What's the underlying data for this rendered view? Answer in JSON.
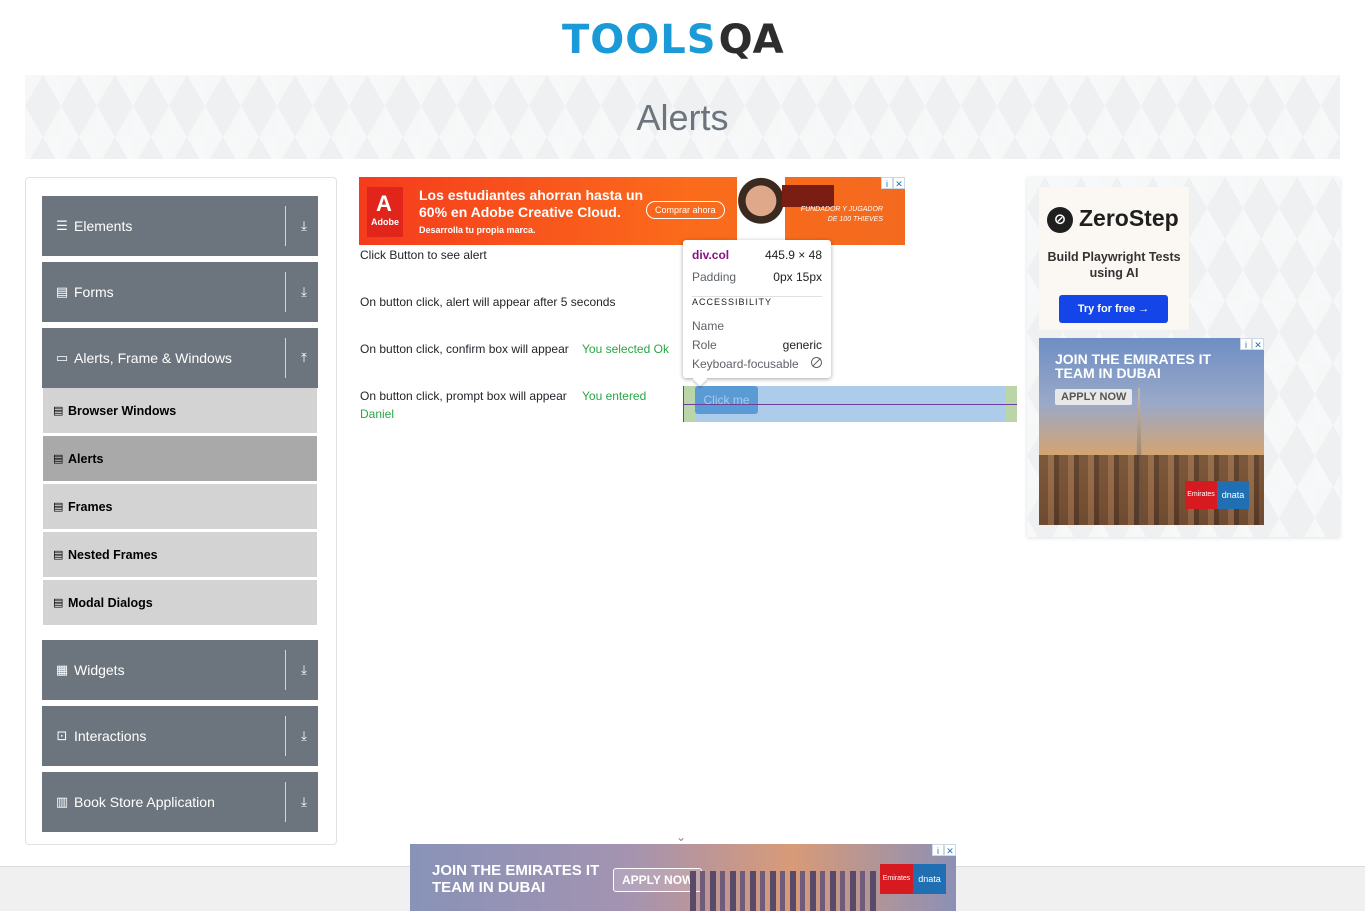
{
  "logo": {
    "text_a": "TOOLS",
    "text_b": "QA"
  },
  "banner": {
    "title": "Alerts"
  },
  "sidebar": {
    "groups": [
      {
        "label": "Elements",
        "icon": "hamburger-icon",
        "arrow": "download-arrow-icon"
      },
      {
        "label": "Forms",
        "icon": "form-icon",
        "arrow": "download-arrow-icon"
      },
      {
        "label": "Alerts, Frame & Windows",
        "icon": "window-icon",
        "arrow": "upload-arrow-icon"
      },
      {
        "label": "Widgets",
        "icon": "grid-icon",
        "arrow": "download-arrow-icon"
      },
      {
        "label": "Interactions",
        "icon": "interactions-icon",
        "arrow": "download-arrow-icon"
      },
      {
        "label": "Book Store Application",
        "icon": "books-icon",
        "arrow": "download-arrow-icon"
      }
    ],
    "sub_items": [
      {
        "label": "Browser Windows",
        "active": false
      },
      {
        "label": "Alerts",
        "active": true
      },
      {
        "label": "Frames",
        "active": false
      },
      {
        "label": "Nested Frames",
        "active": false
      },
      {
        "label": "Modal Dialogs",
        "active": false
      }
    ]
  },
  "ad_top": {
    "brand": "Adobe",
    "headline": "Los estudiantes ahorran hasta un 60% en Adobe Creative Cloud.",
    "subline": "Desarrolla tu propia marca.",
    "cta": "Comprar ahora",
    "tagline": "FUNDADOR Y JUGADOR DE 100 THIEVES"
  },
  "main": {
    "rows": [
      {
        "text": "Click Button to see alert",
        "result": ""
      },
      {
        "text": "On button click, alert will appear after 5 seconds",
        "result": ""
      },
      {
        "text": "On button click, confirm box will appear",
        "result": "You selected Ok"
      },
      {
        "text": "On button click, prompt box will appear",
        "result_a": "You entered",
        "result_b": "Daniel"
      }
    ],
    "highlighted_button": "Click me"
  },
  "inspector": {
    "tag": "div.col",
    "size": "445.9 × 48",
    "padding_label": "Padding",
    "padding_value": "0px 15px",
    "section": "ACCESSIBILITY",
    "name_label": "Name",
    "name_value": "",
    "role_label": "Role",
    "role_value": "generic",
    "focusable_label": "Keyboard-focusable"
  },
  "right_ads": {
    "zerostep": {
      "name": "ZeroStep",
      "sub": "Build Playwright Tests using AI",
      "cta": "Try for free →"
    },
    "emirates": {
      "headline": "JOIN THE EMIRATES IT TEAM IN DUBAI",
      "cta": "APPLY NOW",
      "logo_a": "Emirates",
      "logo_b": "dnata"
    }
  },
  "bottom_ad": {
    "headline": "JOIN THE EMIRATES IT TEAM IN DUBAI",
    "cta": "APPLY NOW",
    "logo_a": "Emirates",
    "logo_b": "dnata"
  },
  "ad_controls": {
    "info": "i",
    "close": "✕"
  },
  "colors": {
    "brand_blue": "#1a9ad6",
    "sidebar_gray": "#6c757d",
    "result_green": "#28a745"
  }
}
